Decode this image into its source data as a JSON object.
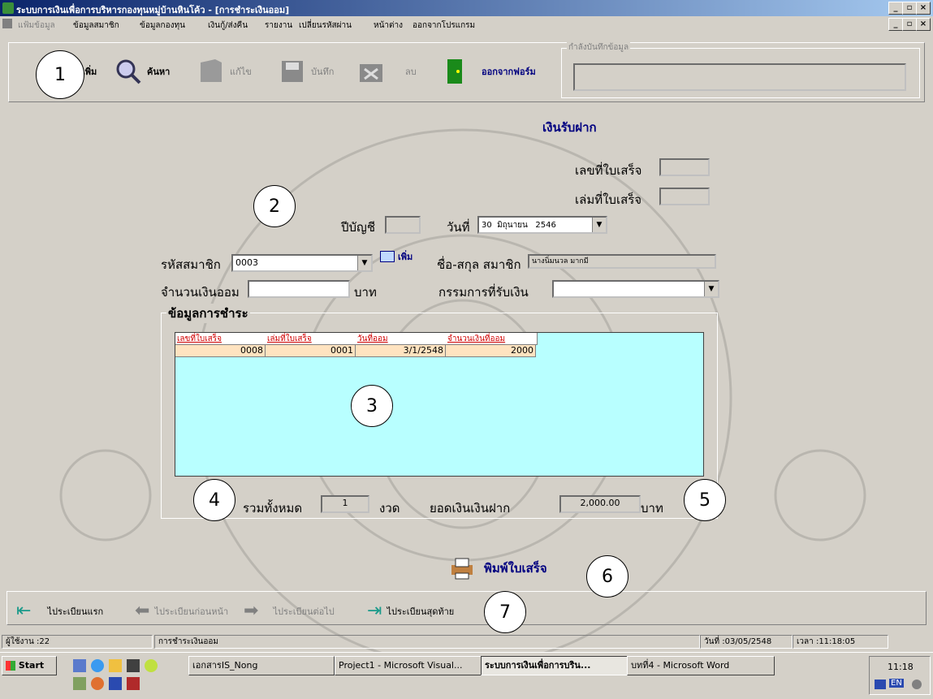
{
  "window": {
    "title": "ระบบการเงินเพื่อการบริหารกองทุนหมู่บ้านหินโค้ว - [การชำระเงินออม]",
    "sys_buttons": [
      "_",
      "▫",
      "×"
    ]
  },
  "menu": [
    "แฟ้มข้อมูล",
    "ข้อมูลสมาชิก",
    "ข้อมูลกองทุน",
    "เงินกู้/ส่งคืน",
    "รายงาน",
    "เปลี่ยนรหัสผ่าน",
    "หน้าต่าง",
    "ออกจากโปรแกรม"
  ],
  "toolbar": {
    "add_label": "เพิ่ม",
    "search_label": "ค้นหา",
    "edit_label": "แก้ไข",
    "save_label": "บันทึก",
    "delete_label": "ลบ",
    "exit_label": "ออกจากฟอร์ม",
    "status_group_label": "กำลังบันทึกข้อมูล",
    "status_value": ""
  },
  "form": {
    "title": "เงินรับฝาก",
    "receipt_no_label": "เลขที่ใบเสร็จ",
    "receipt_no_value": "",
    "receipt_book_label": "เล่มที่ใบเสร็จ",
    "receipt_book_value": "",
    "fiscal_year_label": "ปีบัญชี",
    "fiscal_year_value": "",
    "date_label": "วันที่",
    "date_value": "30  มิถุนายน   2546",
    "member_code_label": "รหัสสมาชิก",
    "member_code_value": "0003",
    "add_member_label": "เพิ่ม",
    "member_name_label": "ชื่อ-สกุล สมาชิก",
    "member_name_value": "นางนิ่มนวล มากมี",
    "savings_amount_label": "จำนวนเงินออม",
    "savings_amount_value": "",
    "baht_label": "บาท",
    "committee_label": "กรรมการที่รับเงิน",
    "committee_value": "",
    "payment_group_label": "ข้อมูลการชำระ",
    "total_label": "รวมทั้งหมด",
    "total_count": "1",
    "installment_label": "งวด",
    "deposit_total_label": "ยอดเงินเงินฝาก",
    "deposit_total_value": "2,000.00",
    "baht_label2": "บาท",
    "print_label": "พิมพ์ใบเสร็จ"
  },
  "grid": {
    "columns": [
      "เลขที่ใบเสร็จ",
      "เล่มที่ใบเสร็จ",
      "วันที่ออม",
      "จำนวนเงินที่ออม"
    ],
    "rows": [
      [
        "0008",
        "0001",
        "3/1/2548",
        "2000"
      ]
    ]
  },
  "navigation": {
    "first": "ไประเบียนแรก",
    "prev": "ไประเบียนก่อนหน้า",
    "next": "ไประเบียนต่อไป",
    "last": "ไประเบียนสุดท้าย"
  },
  "callouts": [
    "1",
    "2",
    "3",
    "4",
    "5",
    "6",
    "7"
  ],
  "statusbar": {
    "user": "ผู้ใช้งาน :22",
    "form_name": "การชำระเงินออม",
    "date": "วันที่ :03/05/2548",
    "time": "เวลา :11:18:05"
  },
  "taskbar": {
    "start": "Start",
    "tasks": [
      "เอกสารIS_Nong",
      "Project1 - Microsoft Visual...",
      "ระบบการเงินเพื่อการบริน...",
      "บทที่4 - Microsoft Word"
    ],
    "clock": "11:18",
    "lang": "EN"
  },
  "colors": {
    "grid_bg": "#b8ffff",
    "header_red": "#d00000",
    "title_blue": "#0a246a",
    "form_title": "#000080"
  }
}
